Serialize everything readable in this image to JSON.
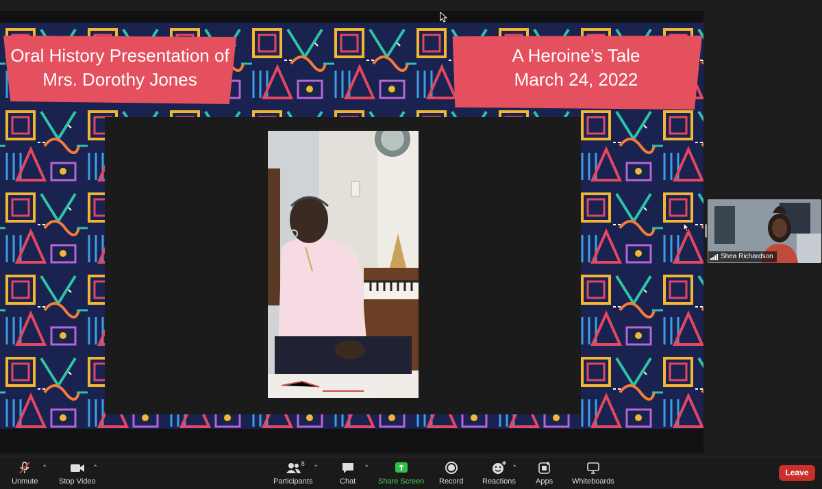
{
  "slide": {
    "banner_left": {
      "line1": "Oral History Presentation of",
      "line2": "Mrs. Dorothy Jones"
    },
    "banner_right": {
      "line1": "A Heroine’s Tale",
      "line2": "March 24, 2022"
    },
    "banner_color": "#e5505e"
  },
  "participant": {
    "name": "Shea Richardson"
  },
  "toolbar": {
    "unmute": "Unmute",
    "stop_video": "Stop Video",
    "participants": "Participants",
    "participants_count": "8",
    "chat": "Chat",
    "share_screen": "Share Screen",
    "record": "Record",
    "reactions": "Reactions",
    "apps": "Apps",
    "whiteboards": "Whiteboards",
    "leave": "Leave",
    "share_color": "#4cd45c",
    "leave_color": "#c9302c"
  },
  "icons": [
    "microphone-muted-icon",
    "video-camera-icon",
    "participants-icon",
    "chat-bubble-icon",
    "share-screen-arrow-icon",
    "record-icon",
    "reaction-smiley-icon",
    "apps-icon",
    "whiteboard-icon",
    "chevron-up-icon",
    "signal-bars-icon",
    "mouse-pointer-icon"
  ]
}
